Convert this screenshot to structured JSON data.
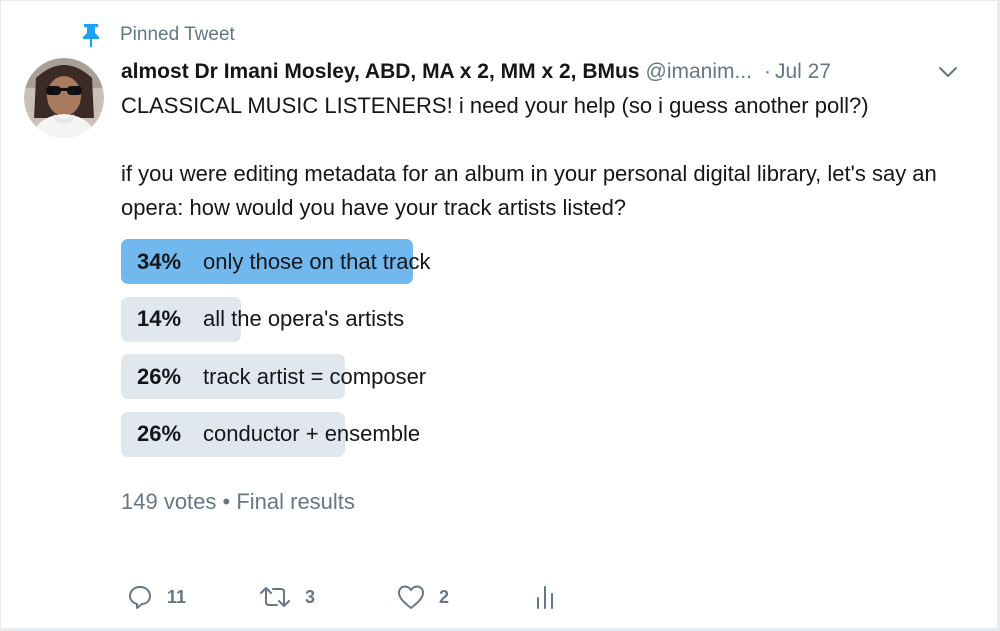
{
  "pinned": {
    "label": "Pinned Tweet",
    "icon": "pin-icon"
  },
  "tweet": {
    "author_name": "almost Dr Imani Mosley, ABD, MA x 2, MM x 2, BMus",
    "handle": "@imanim...",
    "separator": "·",
    "date": "Jul 27",
    "text_line1": "CLASSICAL MUSIC LISTENERS! i need your help (so i guess another poll?)",
    "text_line2": "if you were editing metadata for an album in your personal digital library, let's say an opera: how would you have your track artists listed?"
  },
  "poll": {
    "options": [
      {
        "percent": "34%",
        "label": "only those on that track",
        "fraction": 0.34,
        "winner": true
      },
      {
        "percent": "14%",
        "label": "all the opera's artists",
        "fraction": 0.14,
        "winner": false
      },
      {
        "percent": "26%",
        "label": "track artist = composer",
        "fraction": 0.26,
        "winner": false
      },
      {
        "percent": "26%",
        "label": "conductor + ensemble",
        "fraction": 0.26,
        "winner": false
      }
    ],
    "meta": "149 votes • Final results"
  },
  "actions": {
    "reply_count": "11",
    "retweet_count": "3",
    "like_count": "2"
  },
  "colors": {
    "winner_bar": "#71b8ee",
    "bar": "#e1e8ed",
    "secondary_text": "#657786",
    "accent": "#1da1f2"
  }
}
